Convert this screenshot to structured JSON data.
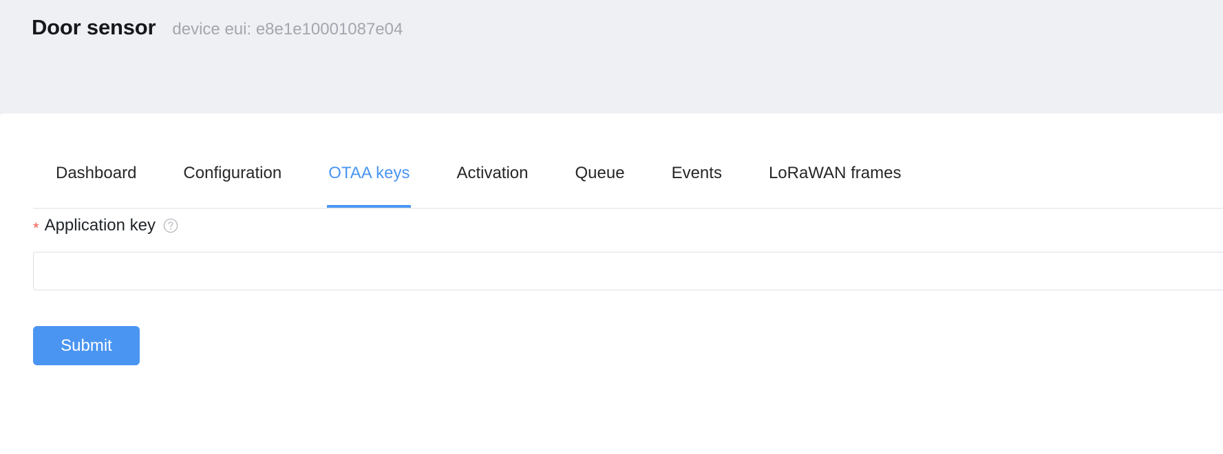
{
  "header": {
    "title": "Door sensor",
    "subtitle": "device eui: e8e1e10001087e04"
  },
  "tabs": {
    "active_index": 2,
    "items": [
      {
        "label": "Dashboard"
      },
      {
        "label": "Configuration"
      },
      {
        "label": "OTAA keys"
      },
      {
        "label": "Activation"
      },
      {
        "label": "Queue"
      },
      {
        "label": "Events"
      },
      {
        "label": "LoRaWAN frames"
      }
    ]
  },
  "form": {
    "required_marker": "*",
    "application_key": {
      "label": "Application key",
      "help_icon": "question-circle-icon",
      "value": "",
      "placeholder": ""
    },
    "submit_label": "Submit"
  },
  "colors": {
    "accent": "#4a95f2",
    "required": "#f15b52",
    "header_bg": "#eff0f4",
    "text": "#1f2429",
    "muted_text": "#a3a6ad",
    "border": "#dcdfe3"
  }
}
